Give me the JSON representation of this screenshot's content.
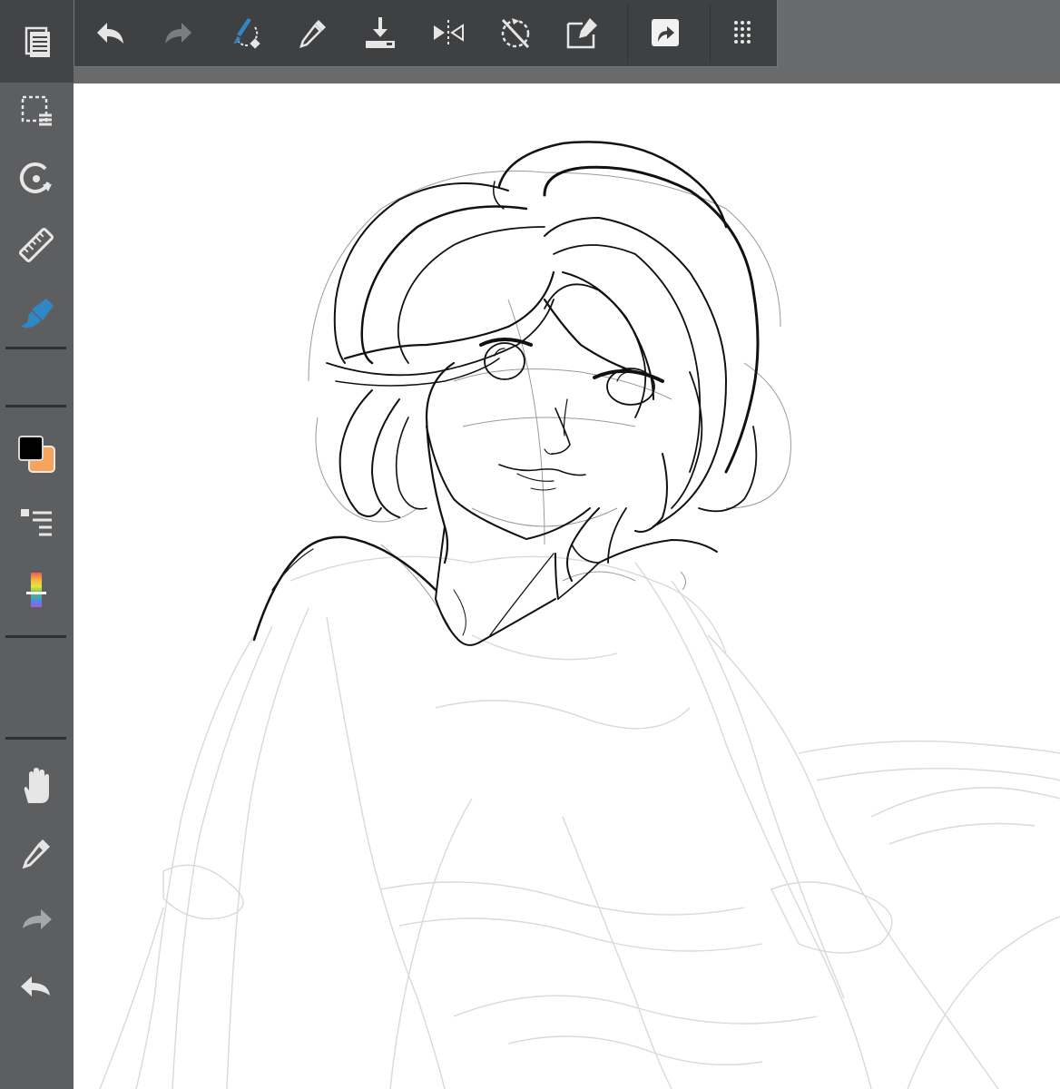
{
  "colors": {
    "accent": "#2f88c5",
    "foreground_color": "#000000",
    "background_color": "#f7a35c",
    "toolbar_bg": "#3f4042",
    "sidebar_bg": "#5d5e60"
  },
  "toolbar": {
    "items": [
      {
        "icon": "undo-icon",
        "enabled": true
      },
      {
        "icon": "redo-icon",
        "enabled": false
      },
      {
        "icon": "brush-transform-icon",
        "active": true
      },
      {
        "icon": "eyedropper-icon"
      },
      {
        "icon": "save-download-icon"
      },
      {
        "icon": "flip-horizontal-icon"
      },
      {
        "icon": "rotation-off-icon"
      },
      {
        "icon": "edit-layer-icon"
      },
      {
        "icon": "share-export-icon"
      },
      {
        "icon": "dot-grid-menu-icon"
      }
    ]
  },
  "sidebar": {
    "items": [
      {
        "icon": "document-menu-icon"
      },
      {
        "icon": "selection-menu-icon"
      },
      {
        "icon": "rotate-view-icon"
      },
      {
        "icon": "ruler-icon"
      },
      {
        "icon": "brush-tool-icon",
        "active": true
      },
      {
        "icon": "color-swatch-icon"
      },
      {
        "icon": "layers-icon"
      },
      {
        "icon": "color-spectrum-icon"
      },
      {
        "icon": "hand-pan-icon"
      },
      {
        "icon": "eyedropper-icon"
      },
      {
        "icon": "redo-icon"
      },
      {
        "icon": "undo-icon"
      }
    ]
  }
}
